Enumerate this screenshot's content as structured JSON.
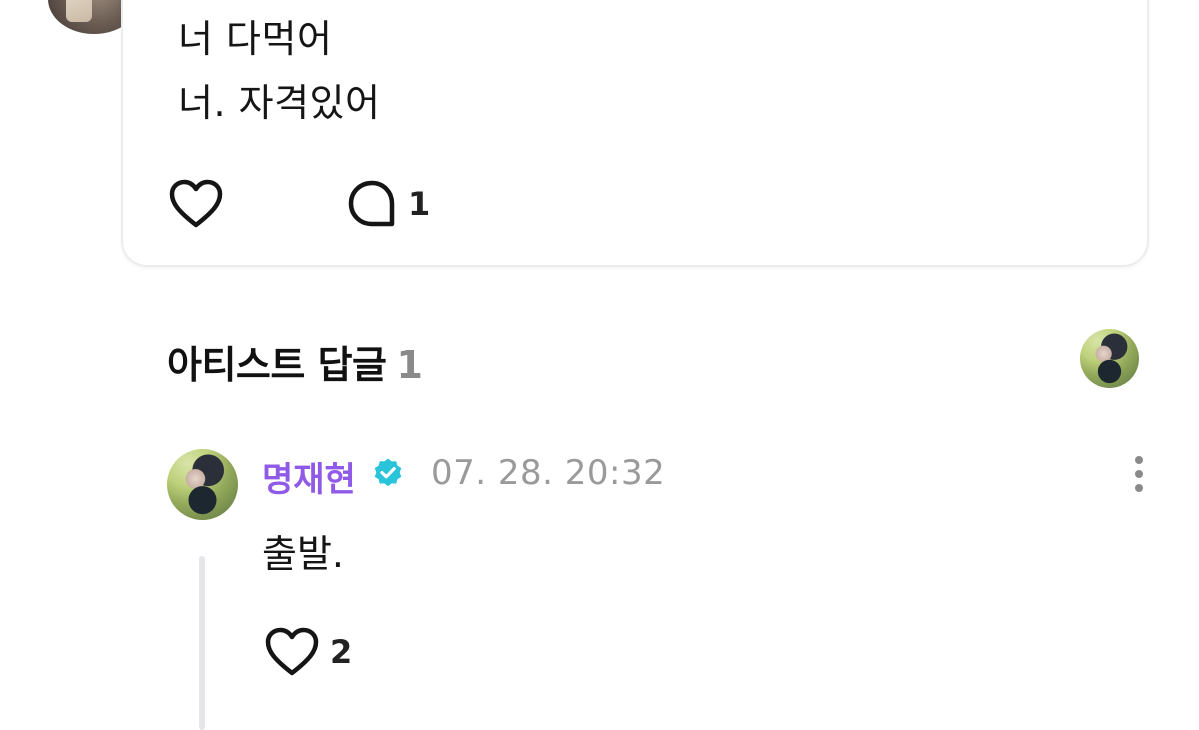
{
  "post": {
    "lines": [
      "너 다먹어",
      "너. 자격있어"
    ],
    "comment_count": "1"
  },
  "artist_replies": {
    "title": "아티스트 답글",
    "count": "1"
  },
  "reply": {
    "author": "명재현",
    "timestamp": "07. 28. 20:32",
    "text": "출발.",
    "like_count": "2"
  },
  "colors": {
    "author_name": "#8f5ae8",
    "verified_badge": "#29c4d9",
    "timestamp": "#9a9a9a",
    "reply_count": "#8a8a8a"
  },
  "icons": {
    "like": "heart-icon",
    "comment": "comment-bubble-icon",
    "verified": "verified-badge-icon",
    "more": "more-vertical-icon"
  }
}
